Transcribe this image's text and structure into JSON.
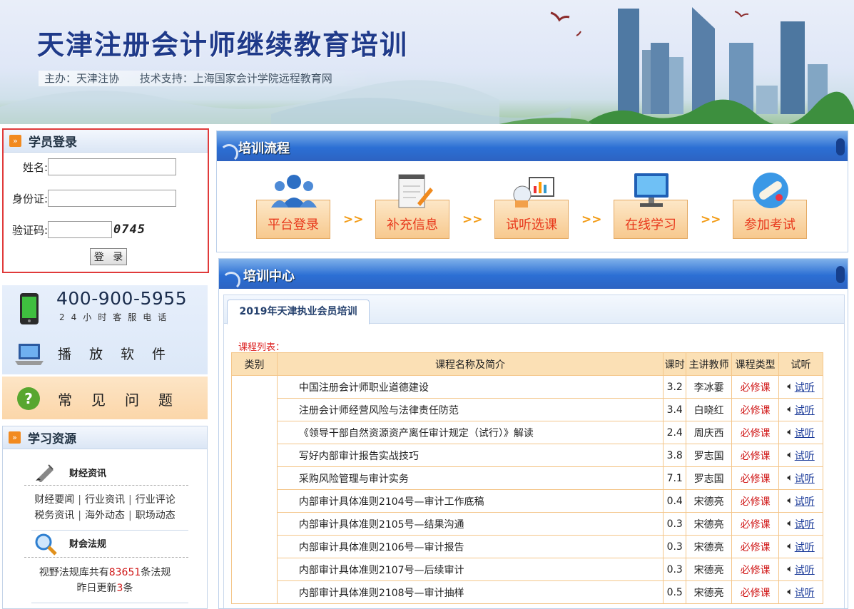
{
  "banner": {
    "title": "天津注册会计师继续教育培训",
    "host": "主办：天津注协",
    "tech": "技术支持：上海国家会计学院远程教育网"
  },
  "login": {
    "heading": "学员登录",
    "name_label": "姓名:",
    "id_label": "身份证:",
    "captcha_label": "验证码:",
    "captcha_value": "0745",
    "button": "登 录"
  },
  "hotline": {
    "number": "400-900-5955",
    "subtitle": "24小时客服电话",
    "player": "播放软件",
    "faq": "常见问题"
  },
  "resources": {
    "heading": "学习资源",
    "finance_news": {
      "title": "财经资讯",
      "links_row1": [
        "财经要闻",
        "行业资讯",
        "行业评论"
      ],
      "links_row2": [
        "税务资讯",
        "海外动态",
        "职场动态"
      ]
    },
    "laws": {
      "title": "财会法规",
      "prefix": "视野法规库共有",
      "count": "83651",
      "suffix": "条法规",
      "update_prefix": "昨日更新",
      "update_count": "3",
      "update_suffix": "条"
    }
  },
  "process": {
    "heading": "培训流程",
    "steps": [
      "平台登录",
      "补充信息",
      "试听选课",
      "在线学习",
      "参加考试"
    ],
    "arrow": ">>"
  },
  "center": {
    "heading": "培训中心",
    "tab": "2019年天津执业会员培训",
    "list_label": "课程列表：",
    "columns": [
      "类别",
      "课程名称及简介",
      "课时",
      "主讲教师",
      "课程类型",
      "试听"
    ],
    "try_label": "试听",
    "courses": [
      {
        "name": "中国注册会计师职业道德建设",
        "hours": "3.2",
        "teacher": "李冰霎",
        "type": "必修课"
      },
      {
        "name": "注册会计师经营风险与法律责任防范",
        "hours": "3.4",
        "teacher": "白晓红",
        "type": "必修课"
      },
      {
        "name": "《领导干部自然资源资产离任审计规定（试行）》解读",
        "hours": "2.4",
        "teacher": "周庆西",
        "type": "必修课"
      },
      {
        "name": "写好内部审计报告实战技巧",
        "hours": "3.8",
        "teacher": "罗志国",
        "type": "必修课"
      },
      {
        "name": "采购风险管理与审计实务",
        "hours": "7.1",
        "teacher": "罗志国",
        "type": "必修课"
      },
      {
        "name": "内部审计具体准则2104号—审计工作底稿",
        "hours": "0.4",
        "teacher": "宋德亮",
        "type": "必修课"
      },
      {
        "name": "内部审计具体准则2105号—结果沟通",
        "hours": "0.3",
        "teacher": "宋德亮",
        "type": "必修课"
      },
      {
        "name": "内部审计具体准则2106号—审计报告",
        "hours": "0.3",
        "teacher": "宋德亮",
        "type": "必修课"
      },
      {
        "name": "内部审计具体准则2107号—后续审计",
        "hours": "0.3",
        "teacher": "宋德亮",
        "type": "必修课"
      },
      {
        "name": "内部审计具体准则2108号—审计抽样",
        "hours": "0.5",
        "teacher": "宋德亮",
        "type": "必修课"
      }
    ]
  }
}
